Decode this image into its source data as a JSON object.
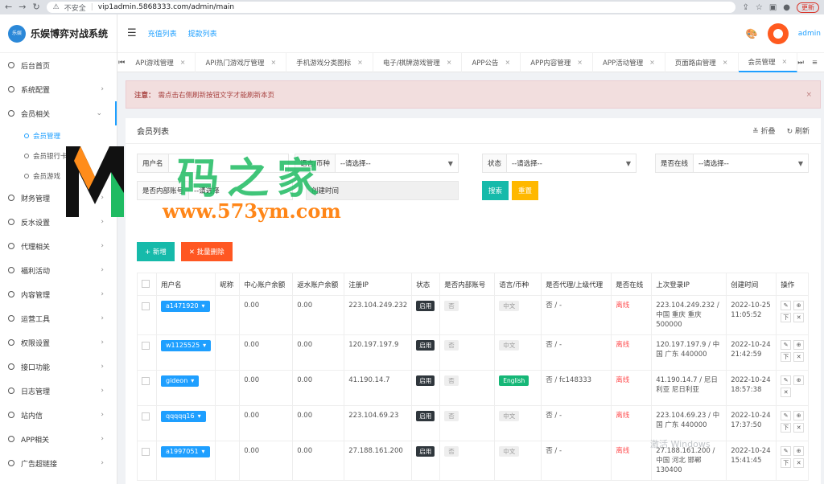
{
  "browser": {
    "insecure_label": "不安全",
    "url": "vip1admin.5868333.com/admin/main",
    "update_label": "更新"
  },
  "sidebar": {
    "logo_mark": "乐娱 ISLEY",
    "logo_text": "乐娱博弈对战系统",
    "items": [
      {
        "label": "后台首页",
        "arrow": ""
      },
      {
        "label": "系统配置",
        "arrow": "›"
      },
      {
        "label": "会员相关",
        "arrow": "⌄"
      },
      {
        "label": "财务管理",
        "arrow": "›"
      },
      {
        "label": "反水设置",
        "arrow": "›"
      },
      {
        "label": "代理相关",
        "arrow": "›"
      },
      {
        "label": "福利活动",
        "arrow": "›"
      },
      {
        "label": "内容管理",
        "arrow": "›"
      },
      {
        "label": "运营工具",
        "arrow": "›"
      },
      {
        "label": "权限设置",
        "arrow": "›"
      },
      {
        "label": "接口功能",
        "arrow": "›"
      },
      {
        "label": "日志管理",
        "arrow": "›"
      },
      {
        "label": "站内信",
        "arrow": "›"
      },
      {
        "label": "APP相关",
        "arrow": "›"
      },
      {
        "label": "广告超链接",
        "arrow": "›"
      }
    ],
    "sub_items": [
      "会员管理",
      "会员银行卡",
      "会员游戏"
    ]
  },
  "topbar": {
    "links": [
      "充值列表",
      "提款列表"
    ],
    "admin_name": "admin"
  },
  "tabs": [
    {
      "label": "API游戏管理"
    },
    {
      "label": "API热门游戏厅管理"
    },
    {
      "label": "手机游戏分类图标"
    },
    {
      "label": "电子/棋牌游戏管理"
    },
    {
      "label": "APP公告"
    },
    {
      "label": "APP内容管理"
    },
    {
      "label": "APP活动管理"
    },
    {
      "label": "页面路由管理"
    },
    {
      "label": "会员管理",
      "active": true
    }
  ],
  "notice": {
    "label": "注意：",
    "text": "需点击右侧刷新按钮文字才能刷新本页",
    "close": "×"
  },
  "member_list": {
    "title": "会员列表",
    "fold_label": "折叠",
    "refresh_label": "刷新"
  },
  "filters": {
    "username_label": "用户名",
    "language_label": "语言/币种",
    "language_value": "--请选择--",
    "status_label": "状态",
    "status_value": "--请选择--",
    "online_label": "是否在线",
    "online_value": "--请选择--",
    "internal_label": "是否内部账号",
    "internal_value": "--请选择",
    "time_placeholder": "创建时间",
    "search_label": "搜索",
    "reset_label": "重置"
  },
  "actions": {
    "new_label": "+ 新增",
    "batch_delete_label": "✕ 批量删除"
  },
  "table": {
    "headers": [
      "",
      "用户名",
      "昵称",
      "中心账户余额",
      "返水账户余额",
      "注册IP",
      "状态",
      "是否内部账号",
      "语言/币种",
      "是否代理/上级代理",
      "是否在线",
      "上次登录IP",
      "创建时间",
      "操作"
    ],
    "rows": [
      {
        "username": "a1471920",
        "nickname": "",
        "center_balance": "0.00",
        "rebate_balance": "0.00",
        "reg_ip": "223.104.249.232",
        "status": "启用",
        "internal": "否",
        "language": "中文",
        "lang_style": "gray",
        "agent": "否 / -",
        "online": "离线",
        "last_ip": "223.104.249.232 / 中国 重庆 重庆 500000",
        "created": "2022-10-25 11:05:52"
      },
      {
        "username": "w1125525",
        "nickname": "",
        "center_balance": "0.00",
        "rebate_balance": "0.00",
        "reg_ip": "120.197.197.9",
        "status": "启用",
        "internal": "否",
        "language": "中文",
        "lang_style": "gray",
        "agent": "否 / -",
        "online": "离线",
        "last_ip": "120.197.197.9 / 中国 广东 440000",
        "created": "2022-10-24 21:42:59"
      },
      {
        "username": "gideon",
        "nickname": "",
        "center_balance": "0.00",
        "rebate_balance": "0.00",
        "reg_ip": "41.190.14.7",
        "status": "启用",
        "internal": "否",
        "language": "English",
        "lang_style": "green",
        "agent": "否 / fc148333",
        "online": "离线",
        "last_ip": "41.190.14.7 / 尼日利亚 尼日利亚",
        "created": "2022-10-24 18:57:38"
      },
      {
        "username": "qqqqq16",
        "nickname": "",
        "center_balance": "0.00",
        "rebate_balance": "0.00",
        "reg_ip": "223.104.69.23",
        "status": "启用",
        "internal": "否",
        "language": "中文",
        "lang_style": "gray",
        "agent": "否 / -",
        "online": "离线",
        "last_ip": "223.104.69.23 / 中国 广东 440000",
        "created": "2022-10-24 17:37:50"
      },
      {
        "username": "a1997051",
        "nickname": "",
        "center_balance": "0.00",
        "rebate_balance": "0.00",
        "reg_ip": "27.188.161.200",
        "status": "启用",
        "internal": "否",
        "language": "中文",
        "lang_style": "gray",
        "agent": "否 / -",
        "online": "离线",
        "last_ip": "27.188.161.200 / 中国 河北 邯郸 130400",
        "created": "2022-10-24 15:41:45"
      }
    ],
    "op_icons": [
      "✎",
      "⊕",
      "下",
      "✕"
    ]
  },
  "watermark": {
    "text": "码之家",
    "url": "www.573ym.com",
    "windows": "激活 Windows"
  },
  "colors": {
    "accent": "#1e9fff",
    "teal": "#16baaa",
    "orange": "#ffb800",
    "red": "#ff5722",
    "offline": "#ff4d4f"
  }
}
